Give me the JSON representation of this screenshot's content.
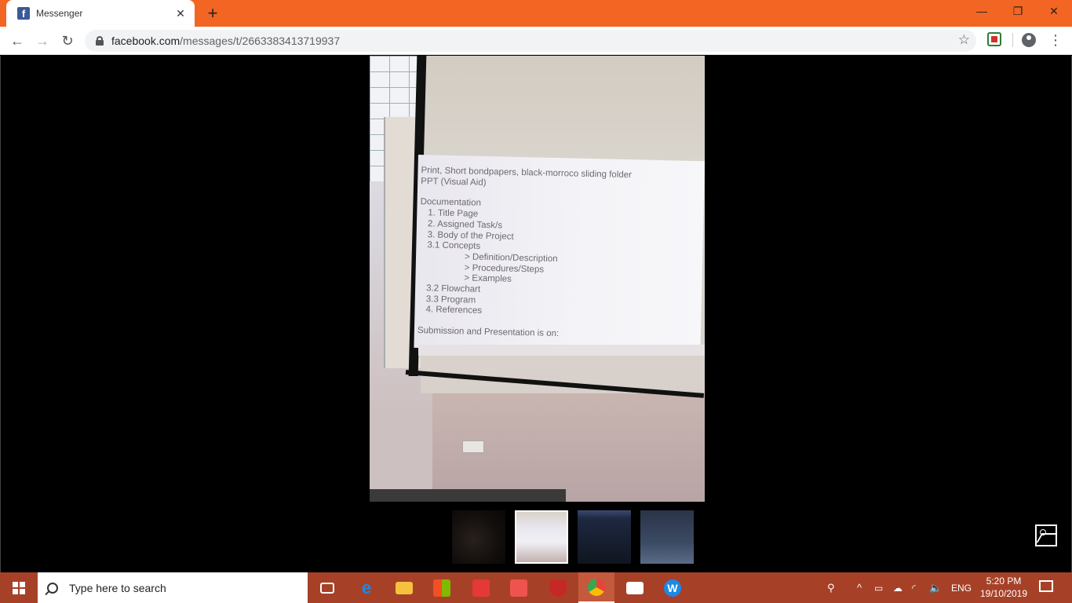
{
  "browser": {
    "tab": {
      "title": "Messenger",
      "favicon": "f"
    },
    "new_tab": "+",
    "window_controls": {
      "minimize": "—",
      "restore": "❐",
      "close": "✕"
    },
    "nav": {
      "back": "←",
      "forward": "→",
      "reload": "↻"
    },
    "url": {
      "host": "facebook.com",
      "path": "/messages/t/2663383413719937"
    },
    "star": "☆",
    "menu": "⋮"
  },
  "photo": {
    "slide_lines": [
      {
        "text": "Print, Short bondpapers, black-morroco sliding  folder",
        "indent": 0
      },
      {
        "text": "PPT (Visual Aid)",
        "indent": 0
      },
      {
        "text": "",
        "indent": -1
      },
      {
        "text": "Documentation",
        "indent": 0
      },
      {
        "text": "1. Title Page",
        "indent": 1
      },
      {
        "text": "2. Assigned Task/s",
        "indent": 1
      },
      {
        "text": "3. Body of the Project",
        "indent": 1
      },
      {
        "text": "3.1 Concepts",
        "indent": 1
      },
      {
        "text": "> Definition/Description",
        "indent": 2
      },
      {
        "text": "> Procedures/Steps",
        "indent": 2
      },
      {
        "text": "> Examples",
        "indent": 2
      },
      {
        "text": "3.2 Flowchart",
        "indent": 1
      },
      {
        "text": "3.3 Program",
        "indent": 1
      },
      {
        "text": "4. References",
        "indent": 1
      },
      {
        "text": "",
        "indent": -1
      },
      {
        "text": "Submission and Presentation is on:",
        "indent": 0
      }
    ]
  },
  "thumbnails": [
    {
      "name": "thumb-dark-photo"
    },
    {
      "name": "thumb-projector-slide"
    },
    {
      "name": "thumb-screen-photo"
    },
    {
      "name": "thumb-monitor-photo"
    }
  ],
  "taskbar": {
    "search_placeholder": "Type here to search",
    "apps": [
      "task-view",
      "edge",
      "file-explorer",
      "store",
      "reader",
      "pdf-app",
      "mcafee",
      "chrome",
      "mail",
      "wps"
    ],
    "tray": {
      "people": "⚲",
      "chevron": "^",
      "lang": "ENG"
    },
    "clock": {
      "time": "5:20 PM",
      "date": "19/10/2019"
    }
  }
}
